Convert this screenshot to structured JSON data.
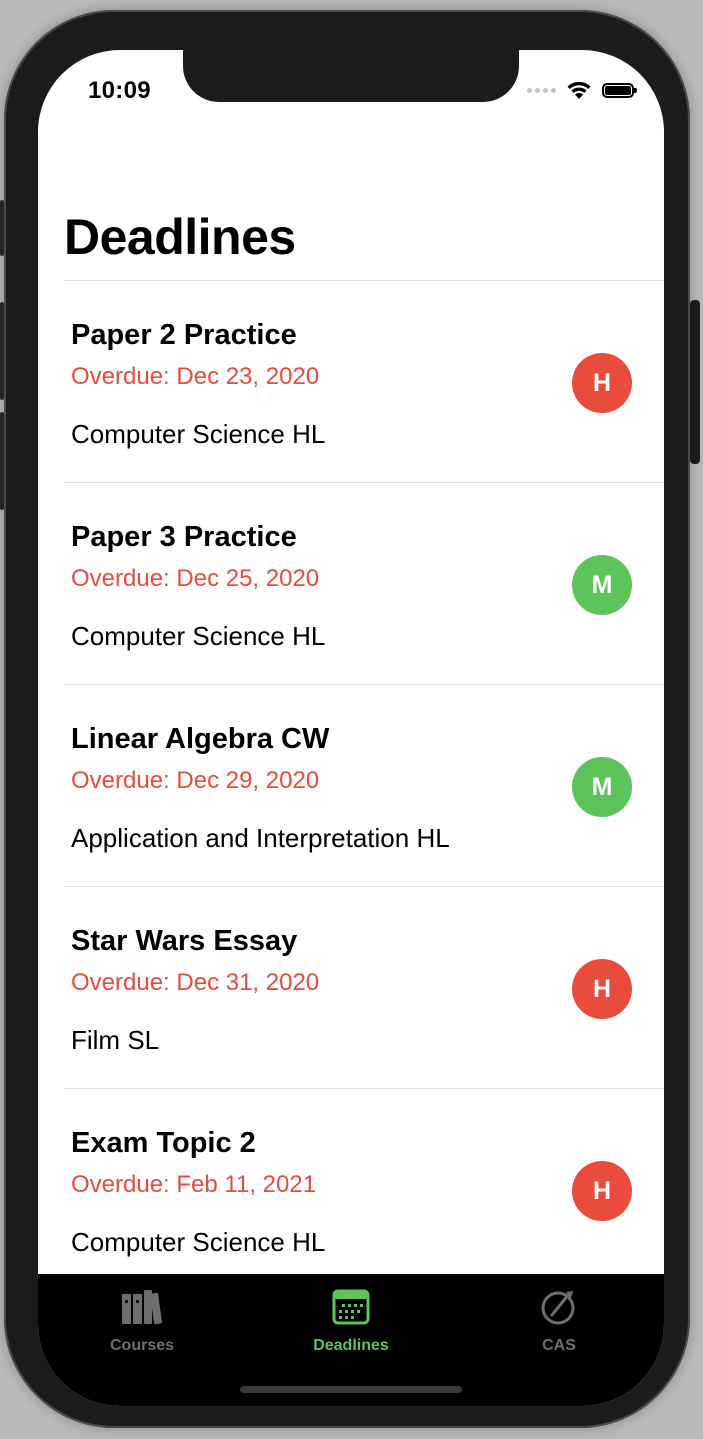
{
  "status_bar": {
    "time": "10:09"
  },
  "page": {
    "title": "Deadlines"
  },
  "deadlines": [
    {
      "title": "Paper 2 Practice",
      "due": "Overdue: Dec 23, 2020",
      "course": "Computer Science HL",
      "priority": "H",
      "priority_color": "#e94b3c"
    },
    {
      "title": "Paper 3 Practice",
      "due": "Overdue: Dec 25, 2020",
      "course": "Computer Science HL",
      "priority": "M",
      "priority_color": "#5cc45b"
    },
    {
      "title": "Linear Algebra CW",
      "due": "Overdue: Dec 29, 2020",
      "course": "Application and Interpretation HL",
      "priority": "M",
      "priority_color": "#5cc45b"
    },
    {
      "title": "Star Wars Essay",
      "due": "Overdue: Dec 31, 2020",
      "course": "Film SL",
      "priority": "H",
      "priority_color": "#e94b3c"
    },
    {
      "title": "Exam Topic 2",
      "due": "Overdue: Feb 11, 2021",
      "course": "Computer Science HL",
      "priority": "H",
      "priority_color": "#e94b3c"
    }
  ],
  "tab_bar": {
    "tabs": [
      {
        "label": "Courses",
        "icon": "books-icon",
        "selected": false
      },
      {
        "label": "Deadlines",
        "icon": "calendar-icon",
        "selected": true
      },
      {
        "label": "CAS",
        "icon": "compass-icon",
        "selected": false
      }
    ],
    "active_color": "#5cc45b",
    "inactive_color": "#6e6e6e"
  }
}
